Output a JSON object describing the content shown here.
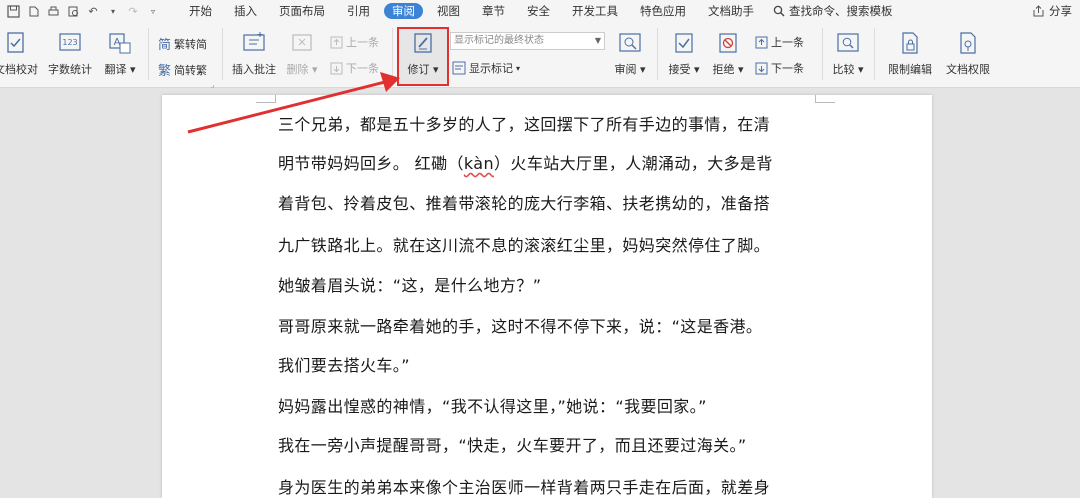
{
  "menubar": {
    "items": [
      "开始",
      "插入",
      "页面布局",
      "引用",
      "审阅",
      "视图",
      "章节",
      "安全",
      "开发工具",
      "特色应用",
      "文档助手"
    ],
    "active": "审阅",
    "search": "查找命令、搜索模板",
    "share": "分享"
  },
  "ribbon": {
    "proofread": "文档校对",
    "wordcount": "字数统计",
    "translate": "翻译",
    "trad": "繁转简",
    "simp": "简转繁",
    "insert_comment": "插入批注",
    "delete": "删除",
    "prev_comment": "上一条",
    "next_comment": "下一条",
    "track": "修订",
    "markup_dropdown": "显示标记的最终状态",
    "show_markup": "显示标记",
    "review": "审阅",
    "accept": "接受",
    "reject": "拒绝",
    "prev_change": "上一条",
    "next_change": "下一条",
    "compare": "比较",
    "restrict": "限制编辑",
    "permission": "文档权限"
  },
  "document": {
    "lines": [
      "三个兄弟，都是五十多岁的人了，这回摆下了所有手边的事情，在清",
      "明节带妈妈回乡。  红磡（",
      "kàn",
      "）火车站大厅里，人潮涌动，大多是背",
      "着背包、拎着皮包、推着带滚轮的庞大行李箱、扶老携幼的，准备搭",
      "九广铁路北上。就在这川流不息的滚滚红尘里，妈妈突然停住了脚。",
      "她皱着眉头说：“这，是什么地方？”",
      "哥哥原来就一路牵着她的手，这时不得不停下来，说：“这是香港。",
      "我们要去搭火车。”",
      "妈妈露出惶惑的神情，“我不认得这里，”她说：“我要回家。”",
      "我在一旁小声提醒哥哥，“快走，火车要开了，而且还要过海关。”",
      "身为医生的弟弟本来像个主治医师一样背着两只手走在后面，就差身"
    ]
  },
  "colors": {
    "accent": "#3c83d8",
    "highlight": "#e03030"
  }
}
